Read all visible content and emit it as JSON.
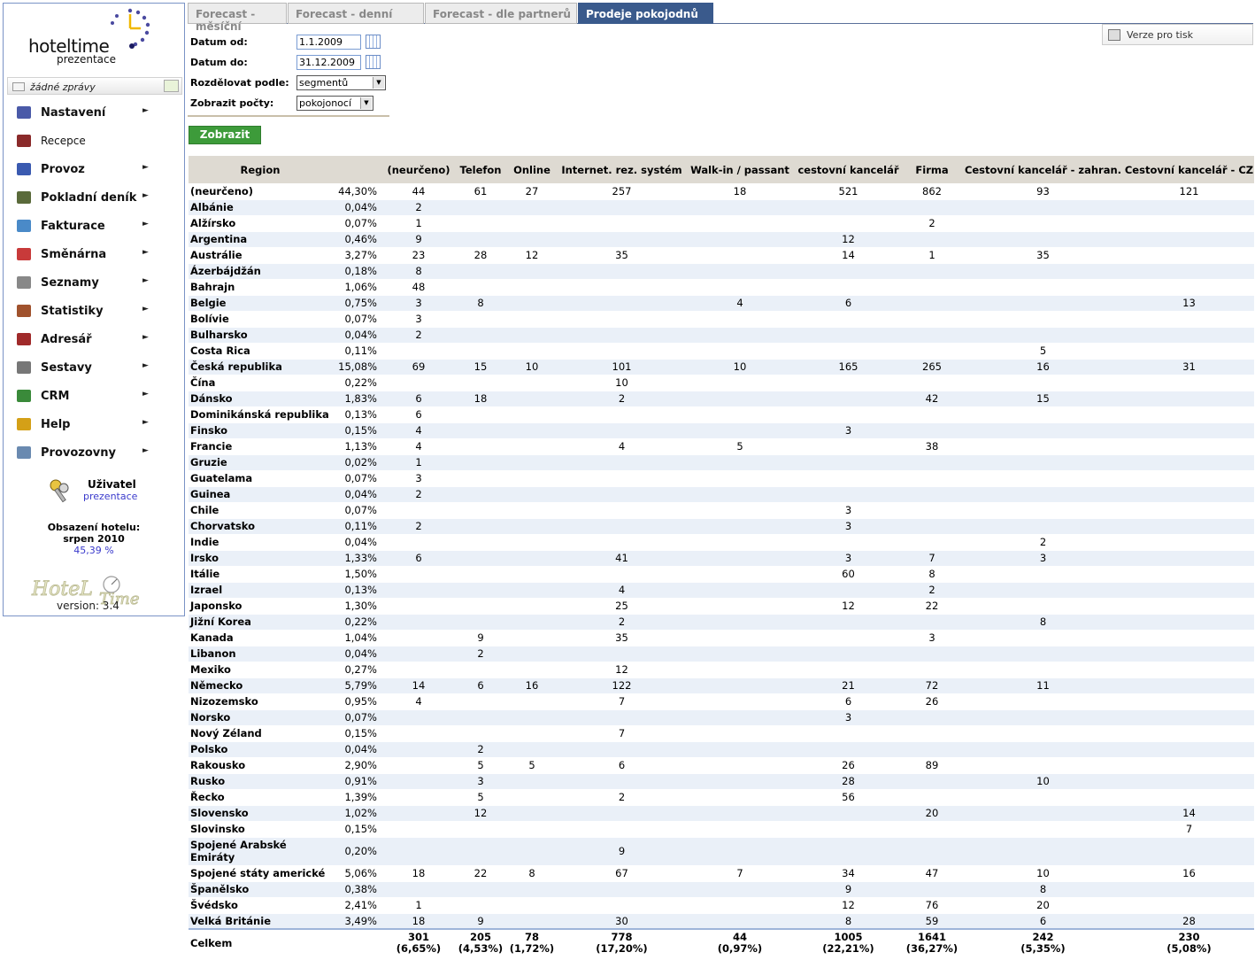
{
  "sidebar": {
    "logo_title": "hoteltime",
    "logo_subtitle": "prezentace",
    "messages": "žádné zprávy",
    "menu": [
      {
        "label": "Nastavení",
        "icon": "settings-icon",
        "color": "#4a5aa8"
      },
      {
        "label": "Recepce",
        "icon": "recepce-icon",
        "color": "#8a2a2a"
      },
      {
        "label": "Provoz",
        "icon": "provoz-icon",
        "color": "#3a5ab0"
      },
      {
        "label": "Pokladní deník",
        "icon": "cashbook-icon",
        "color": "#5a6a3a"
      },
      {
        "label": "Fakturace",
        "icon": "invoice-icon",
        "color": "#4a8ac8"
      },
      {
        "label": "Směnárna",
        "icon": "exchange-icon",
        "color": "#c83a3a"
      },
      {
        "label": "Seznamy",
        "icon": "lists-icon",
        "color": "#888888"
      },
      {
        "label": "Statistiky",
        "icon": "stats-icon",
        "color": "#a0522d"
      },
      {
        "label": "Adresář",
        "icon": "address-book-icon",
        "color": "#a02a2a"
      },
      {
        "label": "Sestavy",
        "icon": "reports-icon",
        "color": "#777777"
      },
      {
        "label": "CRM",
        "icon": "crm-icon",
        "color": "#3a8a3a"
      },
      {
        "label": "Help",
        "icon": "help-icon",
        "color": "#d4a017"
      },
      {
        "label": "Provozovny",
        "icon": "buildings-icon",
        "color": "#6a8ab0"
      }
    ],
    "arrow": "►",
    "user_title": "Uživatel",
    "user_name": "prezentace",
    "occupancy_line1": "Obsazení hotelu:",
    "occupancy_line2": "srpen 2010",
    "occupancy_value": "45,39 %",
    "version": "version: 3.4"
  },
  "tabs": [
    {
      "label": "Forecast - měsíční",
      "active": false
    },
    {
      "label": "Forecast - denní",
      "active": false
    },
    {
      "label": "Forecast - dle partnerů",
      "active": false
    },
    {
      "label": "Prodeje pokojodnů",
      "active": true
    }
  ],
  "print_label": "Verze pro tisk",
  "filters": {
    "date_from_label": "Datum od:",
    "date_from": "1.1.2009",
    "date_to_label": "Datum do:",
    "date_to": "31.12.2009",
    "split_label": "Rozdělovat podle:",
    "split_value": "segmentů",
    "count_label": "Zobrazit počty:",
    "count_value": "pokojonocí"
  },
  "show_button": "Zobrazit",
  "table": {
    "headers": [
      "Region",
      "",
      "(neurčeno)",
      "Telefon",
      "Online",
      "Internet. rez. systém",
      "Walk-in / passant",
      "cestovní kancelář",
      "Firma",
      "Cestovní kancelář - zahran.",
      "Cestovní kancelář - CZ"
    ],
    "rows": [
      [
        "(neurčeno)",
        "44,30%",
        "44",
        "61",
        "27",
        "257",
        "18",
        "521",
        "862",
        "93",
        "121"
      ],
      [
        "Albánie",
        "0,04%",
        "2",
        "",
        "",
        "",
        "",
        "",
        "",
        "",
        ""
      ],
      [
        "Alžírsko",
        "0,07%",
        "1",
        "",
        "",
        "",
        "",
        "",
        "2",
        "",
        ""
      ],
      [
        "Argentina",
        "0,46%",
        "9",
        "",
        "",
        "",
        "",
        "12",
        "",
        "",
        ""
      ],
      [
        "Austrálie",
        "3,27%",
        "23",
        "28",
        "12",
        "35",
        "",
        "14",
        "1",
        "35",
        ""
      ],
      [
        "Ázerbájdžán",
        "0,18%",
        "8",
        "",
        "",
        "",
        "",
        "",
        "",
        "",
        ""
      ],
      [
        "Bahrajn",
        "1,06%",
        "48",
        "",
        "",
        "",
        "",
        "",
        "",
        "",
        ""
      ],
      [
        "Belgie",
        "0,75%",
        "3",
        "8",
        "",
        "",
        "4",
        "6",
        "",
        "",
        "13"
      ],
      [
        "Bolívie",
        "0,07%",
        "3",
        "",
        "",
        "",
        "",
        "",
        "",
        "",
        ""
      ],
      [
        "Bulharsko",
        "0,04%",
        "2",
        "",
        "",
        "",
        "",
        "",
        "",
        "",
        ""
      ],
      [
        "Costa Rica",
        "0,11%",
        "",
        "",
        "",
        "",
        "",
        "",
        "",
        "5",
        ""
      ],
      [
        "Česká republika",
        "15,08%",
        "69",
        "15",
        "10",
        "101",
        "10",
        "165",
        "265",
        "16",
        "31"
      ],
      [
        "Čína",
        "0,22%",
        "",
        "",
        "",
        "10",
        "",
        "",
        "",
        "",
        ""
      ],
      [
        "Dánsko",
        "1,83%",
        "6",
        "18",
        "",
        "2",
        "",
        "",
        "42",
        "15",
        ""
      ],
      [
        "Dominikánská republika",
        "0,13%",
        "6",
        "",
        "",
        "",
        "",
        "",
        "",
        "",
        ""
      ],
      [
        "Finsko",
        "0,15%",
        "4",
        "",
        "",
        "",
        "",
        "3",
        "",
        "",
        ""
      ],
      [
        "Francie",
        "1,13%",
        "4",
        "",
        "",
        "4",
        "5",
        "",
        "38",
        "",
        ""
      ],
      [
        "Gruzie",
        "0,02%",
        "1",
        "",
        "",
        "",
        "",
        "",
        "",
        "",
        ""
      ],
      [
        "Guatelama",
        "0,07%",
        "3",
        "",
        "",
        "",
        "",
        "",
        "",
        "",
        ""
      ],
      [
        "Guinea",
        "0,04%",
        "2",
        "",
        "",
        "",
        "",
        "",
        "",
        "",
        ""
      ],
      [
        "Chile",
        "0,07%",
        "",
        "",
        "",
        "",
        "",
        "3",
        "",
        "",
        ""
      ],
      [
        "Chorvatsko",
        "0,11%",
        "2",
        "",
        "",
        "",
        "",
        "3",
        "",
        "",
        ""
      ],
      [
        "Indie",
        "0,04%",
        "",
        "",
        "",
        "",
        "",
        "",
        "",
        "2",
        ""
      ],
      [
        "Irsko",
        "1,33%",
        "6",
        "",
        "",
        "41",
        "",
        "3",
        "7",
        "3",
        ""
      ],
      [
        "Itálie",
        "1,50%",
        "",
        "",
        "",
        "",
        "",
        "60",
        "8",
        "",
        ""
      ],
      [
        "Izrael",
        "0,13%",
        "",
        "",
        "",
        "4",
        "",
        "",
        "2",
        "",
        ""
      ],
      [
        "Japonsko",
        "1,30%",
        "",
        "",
        "",
        "25",
        "",
        "12",
        "22",
        "",
        ""
      ],
      [
        "Jižní Korea",
        "0,22%",
        "",
        "",
        "",
        "2",
        "",
        "",
        "",
        "8",
        ""
      ],
      [
        "Kanada",
        "1,04%",
        "",
        "9",
        "",
        "35",
        "",
        "",
        "3",
        "",
        ""
      ],
      [
        "Libanon",
        "0,04%",
        "",
        "2",
        "",
        "",
        "",
        "",
        "",
        "",
        ""
      ],
      [
        "Mexiko",
        "0,27%",
        "",
        "",
        "",
        "12",
        "",
        "",
        "",
        "",
        ""
      ],
      [
        "Německo",
        "5,79%",
        "14",
        "6",
        "16",
        "122",
        "",
        "21",
        "72",
        "11",
        ""
      ],
      [
        "Nizozemsko",
        "0,95%",
        "4",
        "",
        "",
        "7",
        "",
        "6",
        "26",
        "",
        ""
      ],
      [
        "Norsko",
        "0,07%",
        "",
        "",
        "",
        "",
        "",
        "3",
        "",
        "",
        ""
      ],
      [
        "Nový Zéland",
        "0,15%",
        "",
        "",
        "",
        "7",
        "",
        "",
        "",
        "",
        ""
      ],
      [
        "Polsko",
        "0,04%",
        "",
        "2",
        "",
        "",
        "",
        "",
        "",
        "",
        ""
      ],
      [
        "Rakousko",
        "2,90%",
        "",
        "5",
        "5",
        "6",
        "",
        "26",
        "89",
        "",
        ""
      ],
      [
        "Rusko",
        "0,91%",
        "",
        "3",
        "",
        "",
        "",
        "28",
        "",
        "10",
        ""
      ],
      [
        "Řecko",
        "1,39%",
        "",
        "5",
        "",
        "2",
        "",
        "56",
        "",
        "",
        ""
      ],
      [
        "Slovensko",
        "1,02%",
        "",
        "12",
        "",
        "",
        "",
        "",
        "20",
        "",
        "14"
      ],
      [
        "Slovinsko",
        "0,15%",
        "",
        "",
        "",
        "",
        "",
        "",
        "",
        "",
        "7"
      ],
      [
        "Spojené Arabské Emiráty",
        "0,20%",
        "",
        "",
        "",
        "9",
        "",
        "",
        "",
        "",
        ""
      ],
      [
        "Spojené státy americké",
        "5,06%",
        "18",
        "22",
        "8",
        "67",
        "7",
        "34",
        "47",
        "10",
        "16"
      ],
      [
        "Španělsko",
        "0,38%",
        "",
        "",
        "",
        "",
        "",
        "9",
        "",
        "8",
        ""
      ],
      [
        "Švédsko",
        "2,41%",
        "1",
        "",
        "",
        "",
        "",
        "12",
        "76",
        "20",
        ""
      ],
      [
        "Velká Británie",
        "3,49%",
        "18",
        "9",
        "",
        "30",
        "",
        "8",
        "59",
        "6",
        "28"
      ]
    ],
    "total_label": "Celkem",
    "totals": [
      [
        "301",
        "(6,65%)"
      ],
      [
        "205",
        "(4,53%)"
      ],
      [
        "78",
        "(1,72%)"
      ],
      [
        "778",
        "(17,20%)"
      ],
      [
        "44",
        "(0,97%)"
      ],
      [
        "1005",
        "(22,21%)"
      ],
      [
        "1641",
        "(36,27%)"
      ],
      [
        "242",
        "(5,35%)"
      ],
      [
        "230",
        "(5,08%)"
      ]
    ]
  }
}
